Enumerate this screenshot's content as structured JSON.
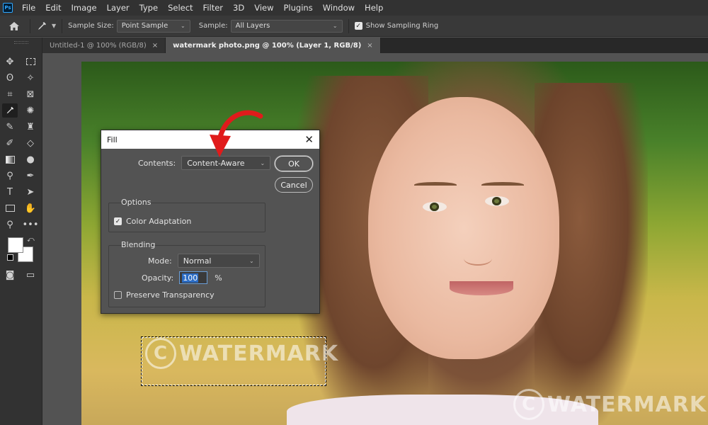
{
  "menubar": {
    "logo": "Ps",
    "items": [
      "File",
      "Edit",
      "Image",
      "Layer",
      "Type",
      "Select",
      "Filter",
      "3D",
      "View",
      "Plugins",
      "Window",
      "Help"
    ]
  },
  "options": {
    "sample_size_label": "Sample Size:",
    "sample_size_value": "Point Sample",
    "sample_label": "Sample:",
    "sample_value": "All Layers",
    "show_ring_label": "Show Sampling Ring"
  },
  "tabs": [
    {
      "label": "Untitled-1 @ 100% (RGB/8)",
      "close": "×"
    },
    {
      "label": "watermark photo.png @ 100% (Layer 1, RGB/8)",
      "close": "×"
    }
  ],
  "canvas": {
    "watermark_1": "WATERMARK",
    "watermark_2": "WATERMARK",
    "copyright_symbol": "C"
  },
  "dialog": {
    "title": "Fill",
    "close": "✕",
    "contents_label": "Contents:",
    "contents_value": "Content-Aware",
    "ok_label": "OK",
    "cancel_label": "Cancel",
    "options_title": "Options",
    "color_adaptation_label": "Color Adaptation",
    "blending_title": "Blending",
    "mode_label": "Mode:",
    "mode_value": "Normal",
    "opacity_label": "Opacity:",
    "opacity_value": "100",
    "opacity_unit": "%",
    "preserve_label": "Preserve Transparency"
  },
  "colors": {
    "annotation_arrow": "#e01b1b",
    "foreground": "#ffffff",
    "background": "#ffffff"
  }
}
